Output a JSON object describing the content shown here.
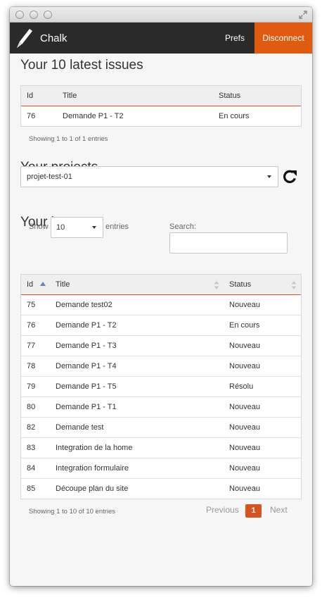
{
  "navbar": {
    "brand": "Chalk",
    "prefs_label": "Prefs",
    "disconnect_label": "Disconnect",
    "accent_color": "#e05b0f"
  },
  "latest": {
    "heading": "Your 10 latest issues",
    "columns": [
      "Id",
      "Title",
      "Status"
    ],
    "rows": [
      {
        "id": "76",
        "title": "Demande P1 - T2",
        "status": "En cours"
      }
    ],
    "info": "Showing 1 to 1 of 1 entries"
  },
  "projects": {
    "heading": "Your projects",
    "selected": "projet-test-01",
    "refresh_icon": "refresh-icon"
  },
  "issues": {
    "heading": "Your issues",
    "show_label": "Show",
    "page_length": "10",
    "entries_label": "entries",
    "search_label": "Search:",
    "search_value": "",
    "columns": [
      "Id",
      "Title",
      "Status"
    ],
    "rows": [
      {
        "id": "75",
        "title": "Demande test02",
        "status": "Nouveau"
      },
      {
        "id": "76",
        "title": "Demande P1 - T2",
        "status": "En cours"
      },
      {
        "id": "77",
        "title": "Demande P1 - T3",
        "status": "Nouveau"
      },
      {
        "id": "78",
        "title": "Demande P1 - T4",
        "status": "Nouveau"
      },
      {
        "id": "79",
        "title": "Demande P1 - T5",
        "status": "Résolu"
      },
      {
        "id": "80",
        "title": "Demande P1 - T1",
        "status": "Nouveau"
      },
      {
        "id": "82",
        "title": "Demande test",
        "status": "Nouveau"
      },
      {
        "id": "83",
        "title": "Integration de la home",
        "status": "Nouveau"
      },
      {
        "id": "84",
        "title": "Integration formulaire",
        "status": "Nouveau"
      },
      {
        "id": "85",
        "title": "Découpe plan du site",
        "status": "Nouveau"
      }
    ],
    "info": "Showing 1 to 10 of 10 entries",
    "pagination": {
      "previous": "Previous",
      "current": "1",
      "next": "Next"
    }
  }
}
